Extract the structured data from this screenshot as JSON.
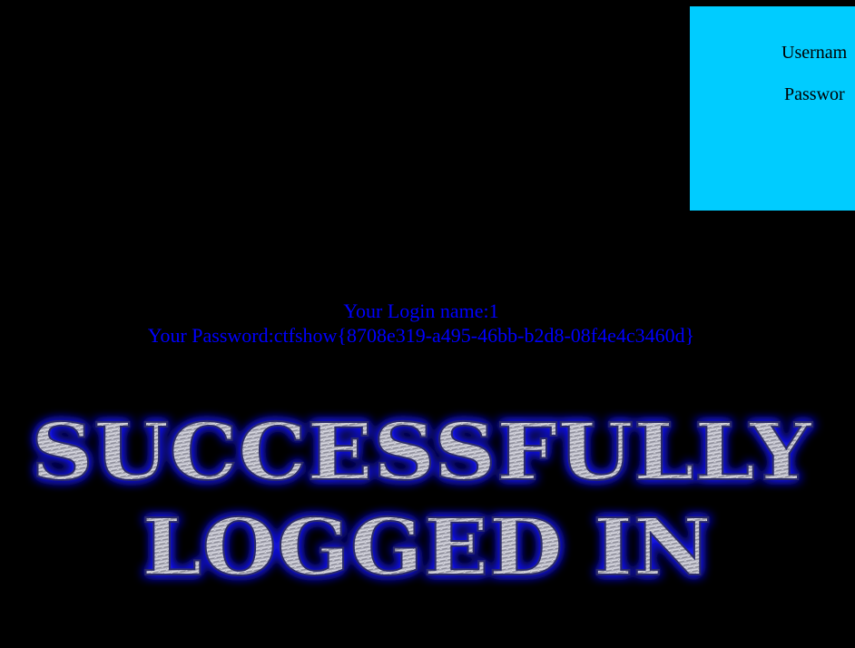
{
  "login_form": {
    "username_label": "Usernam",
    "password_label": "Passwor"
  },
  "result": {
    "login_name_text": "Your Login name:1",
    "password_text": "Your Password:ctfshow{8708e319-a495-46bb-b2d8-08f4e4c3460d}"
  },
  "banner": {
    "line1": "SUCCESSFULLY",
    "line2": "LOGGED IN",
    "glow_color": "#1a1aff",
    "metal_light": "#e6e6ee",
    "metal_dark": "#6b6b78"
  },
  "colors": {
    "background": "#000000",
    "panel": "#00ccff",
    "result_text": "#0000ff"
  }
}
